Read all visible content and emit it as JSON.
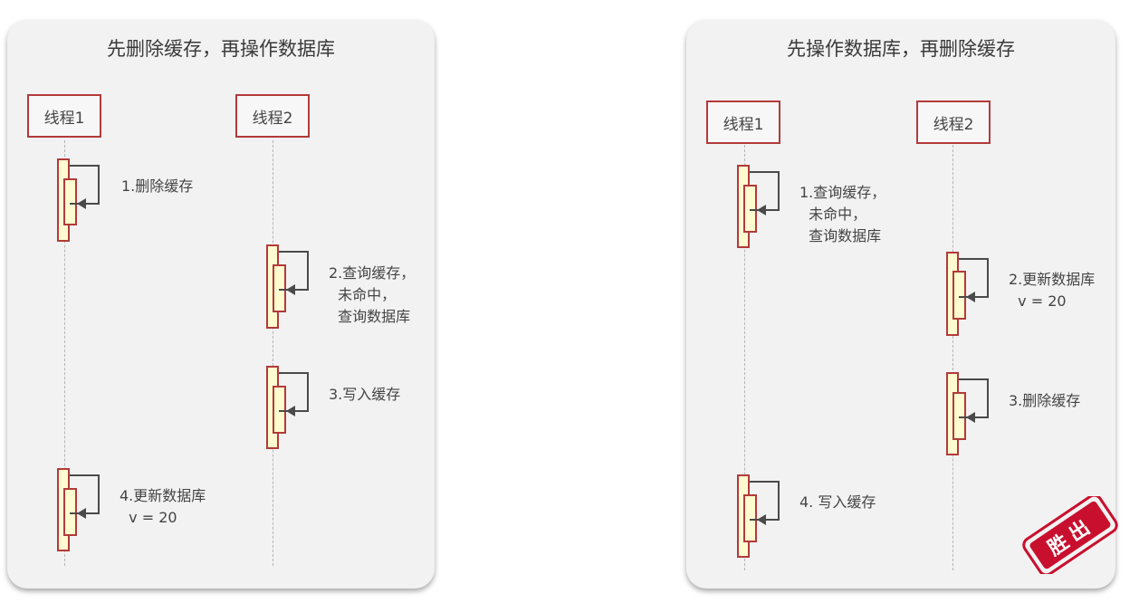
{
  "left_panel": {
    "title": "先删除缓存，再操作数据库",
    "actor1": "线程1",
    "actor2": "线程2",
    "step1": "1.删除缓存",
    "step2": "2.查询缓存，\n  未命中，\n  查询数据库",
    "step3": "3.写入缓存",
    "step4": "4.更新数据库\n  v = 20"
  },
  "right_panel": {
    "title": "先操作数据库，再删除缓存",
    "actor1": "线程1",
    "actor2": "线程2",
    "step1": "1.查询缓存，\n  未命中，\n  查询数据库",
    "step2": "2.更新数据库\n  v = 20",
    "step3": "3.删除缓存",
    "step4": "4. 写入缓存",
    "stamp_text": "胜出"
  },
  "colors": {
    "border_red": "#b23a3a",
    "activation_fill": "#fffbd0",
    "panel_bg": "#f2f2f2",
    "stamp_red": "#c8102e"
  }
}
